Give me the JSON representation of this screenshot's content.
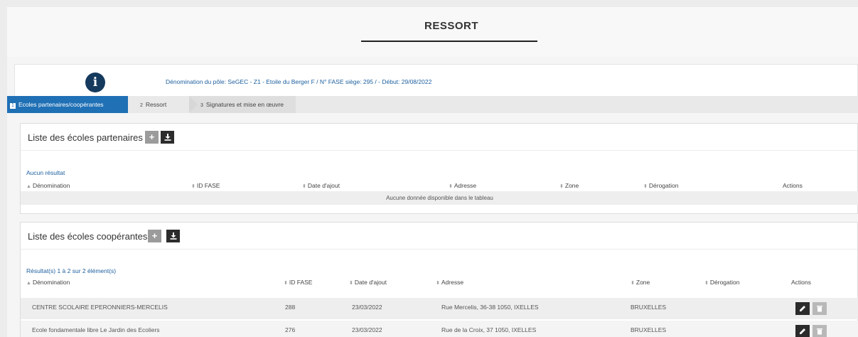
{
  "header": {
    "title": "RESSORT"
  },
  "info": {
    "icon": "info-icon",
    "text": "Dénomination du pôle: SeGEC - Z1 - Etoile du Berger F / N° FASE siège: 295 / - Début: 29/08/2022"
  },
  "steps": [
    {
      "num": "1",
      "label": "Ecoles partenaires/coopérantes",
      "active": true
    },
    {
      "num": "2",
      "label": "Ressort",
      "active": false
    },
    {
      "num": "3",
      "label": "Signatures et mise en œuvre",
      "active": false
    }
  ],
  "partners": {
    "title": "Liste des écoles partenaires",
    "add_icon": "plus-icon",
    "download_icon": "download-icon",
    "result_text": "Aucun résultat",
    "columns": [
      "Dénomination",
      "ID FASE",
      "Date d'ajout",
      "Adresse",
      "Zone",
      "Dérogation",
      "Actions"
    ],
    "empty_text": "Aucune donnée disponible dans le tableau"
  },
  "cooperating": {
    "title": "Liste des écoles coopérantes",
    "add_icon": "plus-icon",
    "download_icon": "download-icon",
    "result_text": "Résultat(s) 1 à 2 sur 2 élément(s)",
    "columns": [
      "Dénomination",
      "ID FASE",
      "Date d'ajout",
      "Adresse",
      "Zone",
      "Dérogation",
      "Actions"
    ],
    "rows": [
      {
        "denomination": "CENTRE SCOLAIRE EPERONNIERS-MERCELIS",
        "id_fase": "288",
        "date": "23/03/2022",
        "adresse": "Rue Mercelis, 36-38 1050, IXELLES",
        "zone": "BRUXELLES",
        "derogation": ""
      },
      {
        "denomination": "Ecole fondamentale libre Le Jardin des Ecoliers",
        "id_fase": "276",
        "date": "23/03/2022",
        "adresse": "Rue de la Croix, 37 1050, IXELLES",
        "zone": "BRUXELLES",
        "derogation": ""
      }
    ]
  },
  "colors": {
    "accent": "#1f70b5",
    "icon_dark": "#153a5e",
    "link": "#1d5f9e"
  }
}
